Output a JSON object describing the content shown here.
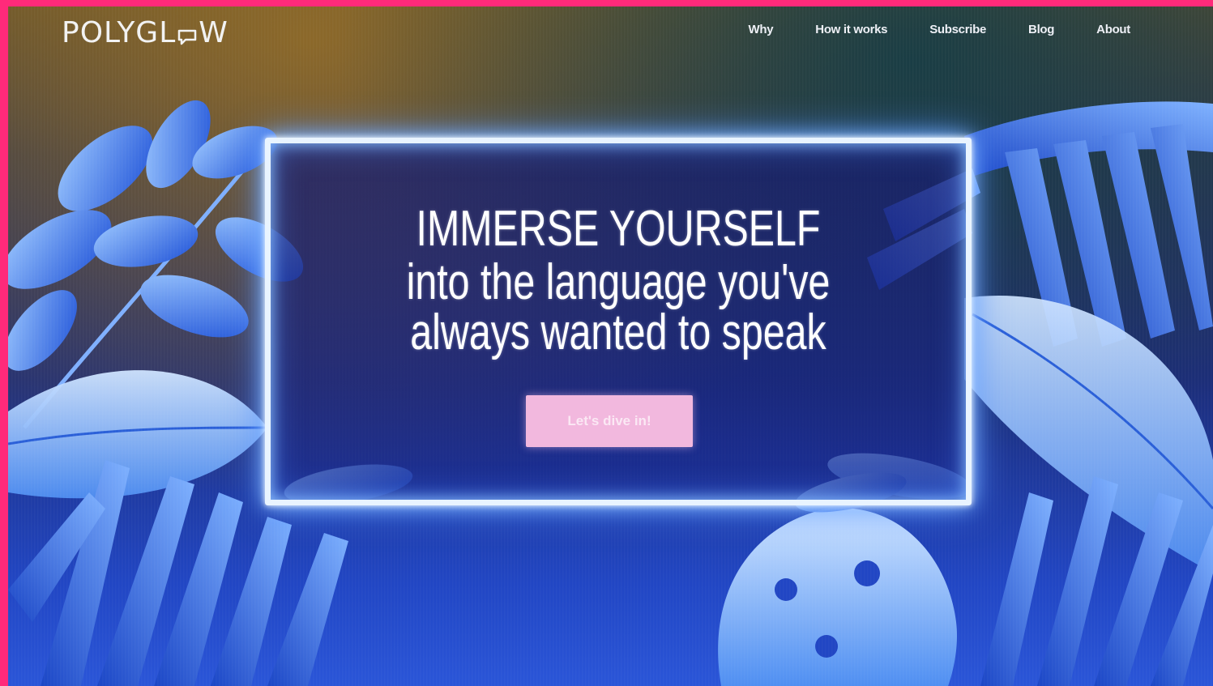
{
  "brand": {
    "logo_text_before": "POLYGL",
    "logo_text_after": "W",
    "logo_icon": "speech-bubble-icon"
  },
  "nav": {
    "items": [
      {
        "label": "Why"
      },
      {
        "label": "How it works"
      },
      {
        "label": "Subscribe"
      },
      {
        "label": "Blog"
      },
      {
        "label": "About"
      }
    ]
  },
  "hero": {
    "headline": "IMMERSE YOURSELF",
    "subline_1": "into the language you've",
    "subline_2": "always wanted to speak",
    "cta_label": "Let's dive in!"
  },
  "colors": {
    "page_border": "#ff2a7a",
    "neon": "#e9f4ff",
    "cta_background": "#f2b8de",
    "leaf_blue": "#3f86f0"
  }
}
